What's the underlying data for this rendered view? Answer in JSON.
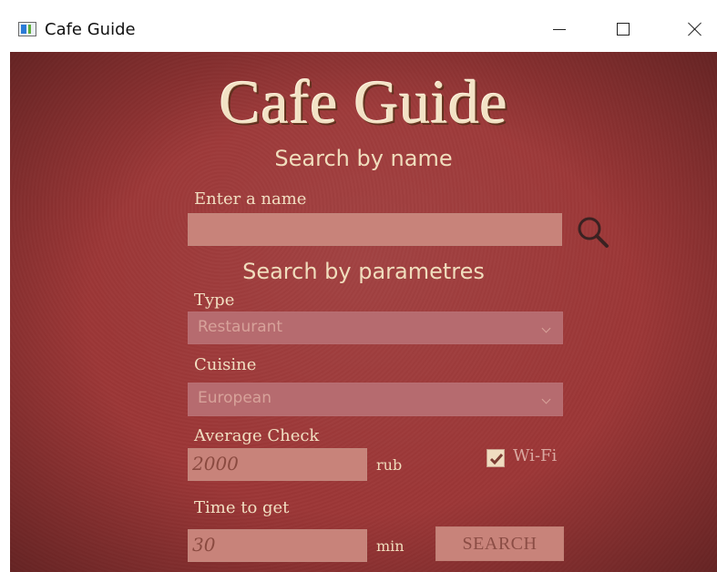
{
  "window": {
    "title": "Cafe Guide"
  },
  "app": {
    "heading": "Cafe Guide",
    "search_by_name": {
      "section_title": "Search by name",
      "name_label": "Enter a name",
      "name_value": ""
    },
    "search_by_params": {
      "section_title": "Search by parametres",
      "type_label": "Type",
      "type_selected": "Restaurant",
      "cuisine_label": "Cuisine",
      "cuisine_selected": "European",
      "avg_check_label": "Average Check",
      "avg_check_value": "2000",
      "avg_check_unit": "rub",
      "wifi_label": "Wi-Fi",
      "wifi_checked": true,
      "time_label": "Time to get",
      "time_value": "30",
      "time_unit": "min",
      "search_button": "SEARCH"
    }
  },
  "icons": {
    "app": "app-window-icon",
    "minimize": "minimize-icon",
    "maximize": "maximize-icon",
    "close": "close-icon",
    "search": "magnifier-icon",
    "dropdown": "chevron-down-icon",
    "check": "checkmark-icon"
  },
  "colors": {
    "background": "#9c3737",
    "text_cream": "#f0ddbd",
    "field_bg": "#c8837a",
    "select_bg": "#b66b6f"
  }
}
